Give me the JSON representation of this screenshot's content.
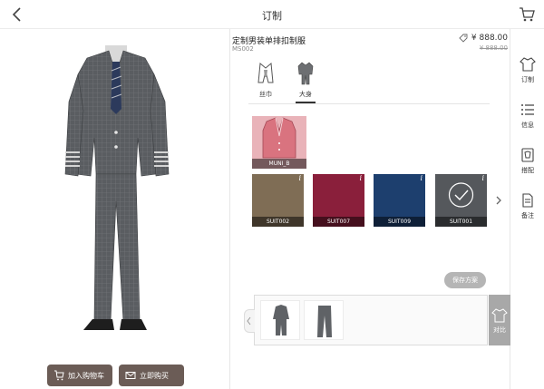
{
  "header": {
    "title": "订制"
  },
  "product": {
    "name": "定制男装单排扣制服",
    "code": "MS002",
    "price": "¥ 888.00",
    "original_price": "¥ 888.00"
  },
  "categories": [
    {
      "label": "丝巾",
      "icon": "scarf-icon"
    },
    {
      "label": "大身",
      "icon": "jacket-icon"
    }
  ],
  "selected_fabric": {
    "label": "MUNI_B"
  },
  "fabrics": [
    {
      "code": "SUIT002",
      "color": "#7f6d55"
    },
    {
      "code": "SUIT007",
      "color": "#8a1f3b"
    },
    {
      "code": "SUIT009",
      "color": "#1d3f6e"
    },
    {
      "code": "SUIT001",
      "color": "#55585c"
    }
  ],
  "info_glyph": "i",
  "save_button": "保存方案",
  "compare": {
    "label": "对比"
  },
  "actions": {
    "add_to_cart": "加入购物车",
    "buy_now": "立即购买"
  },
  "side_nav": [
    {
      "label": "订制",
      "icon": "tshirt-icon"
    },
    {
      "label": "信息",
      "icon": "list-icon"
    },
    {
      "label": "搭配",
      "icon": "hanger-icon"
    },
    {
      "label": "备注",
      "icon": "note-icon"
    }
  ]
}
